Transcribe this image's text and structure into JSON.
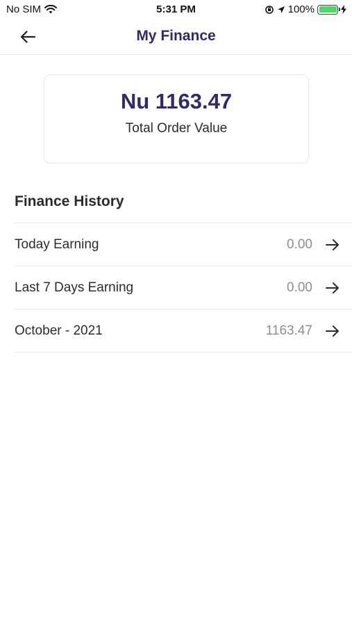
{
  "status_bar": {
    "carrier": "No SIM",
    "time": "5:31 PM",
    "battery": "100%",
    "battery_level": 1.0,
    "icons": [
      "wifi-icon",
      "orientation-lock-icon",
      "location-icon",
      "battery-icon",
      "charging-icon"
    ]
  },
  "nav": {
    "title": "My Finance",
    "back_icon": "back-arrow-icon"
  },
  "summary": {
    "amount": "Nu 1163.47",
    "label": "Total Order Value"
  },
  "history": {
    "title": "Finance History",
    "rows": [
      {
        "label": "Today Earning",
        "value": "0.00"
      },
      {
        "label": "Last 7 Days Earning",
        "value": "0.00"
      },
      {
        "label": "October - 2021",
        "value": "1163.47"
      }
    ]
  },
  "colors": {
    "accent": "#2e2a6b",
    "text": "#2b2b2b",
    "muted": "#8e8e8e",
    "battery_green": "#4cd964"
  }
}
